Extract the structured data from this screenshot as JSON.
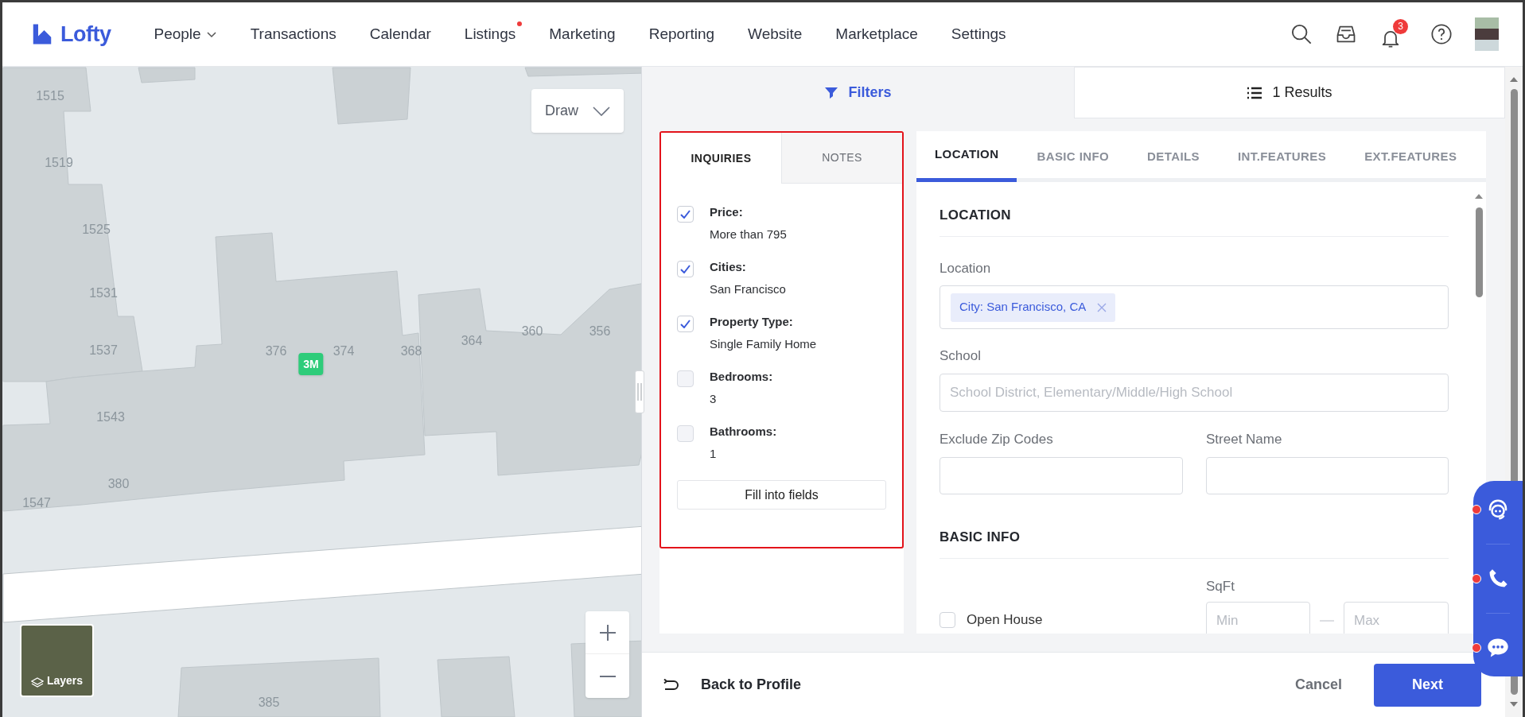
{
  "nav": {
    "logo": "Lofty",
    "items": [
      {
        "label": "People",
        "has_menu": true,
        "has_dot": false
      },
      {
        "label": "Transactions",
        "has_menu": false,
        "has_dot": false
      },
      {
        "label": "Calendar",
        "has_menu": false,
        "has_dot": false
      },
      {
        "label": "Listings",
        "has_menu": false,
        "has_dot": true
      },
      {
        "label": "Marketing",
        "has_menu": false,
        "has_dot": false
      },
      {
        "label": "Reporting",
        "has_menu": false,
        "has_dot": false
      },
      {
        "label": "Website",
        "has_menu": false,
        "has_dot": false
      },
      {
        "label": "Marketplace",
        "has_menu": false,
        "has_dot": false
      },
      {
        "label": "Settings",
        "has_menu": false,
        "has_dot": false
      }
    ],
    "notification_count": "3"
  },
  "map": {
    "house_numbers": [
      "1515",
      "1519",
      "1525",
      "1531",
      "1537",
      "1543",
      "380",
      "1547",
      "376",
      "374",
      "368",
      "364",
      "360",
      "356",
      "385"
    ],
    "marker": "3M",
    "draw_button": "Draw",
    "layers_button": "Layers"
  },
  "view_tabs": [
    {
      "label": "Filters",
      "kind": "filter",
      "selected": true
    },
    {
      "label": "1 Results",
      "kind": "list",
      "selected": false
    }
  ],
  "inquiries": {
    "tabs": [
      {
        "label": "INQUIRIES",
        "selected": true
      },
      {
        "label": "NOTES",
        "selected": false
      }
    ],
    "items": [
      {
        "label": "Price:",
        "value": "More than 795",
        "checked": true
      },
      {
        "label": "Cities:",
        "value": "San Francisco",
        "checked": true
      },
      {
        "label": "Property Type:",
        "value": "Single Family Home",
        "checked": true
      },
      {
        "label": "Bedrooms:",
        "value": "3",
        "checked": false
      },
      {
        "label": "Bathrooms:",
        "value": "1",
        "checked": false
      }
    ],
    "fill_button": "Fill into fields"
  },
  "form": {
    "tabs": [
      {
        "label": "LOCATION",
        "selected": true
      },
      {
        "label": "BASIC INFO",
        "selected": false
      },
      {
        "label": "DETAILS",
        "selected": false
      },
      {
        "label": "INT.FEATURES",
        "selected": false
      },
      {
        "label": "EXT.FEATURES",
        "selected": false
      }
    ],
    "location_heading": "LOCATION",
    "location_label": "Location",
    "location_tags": [
      "City: San Francisco, CA"
    ],
    "school_label": "School",
    "school_placeholder": "School District, Elementary/Middle/High School",
    "exclude_zip_label": "Exclude Zip Codes",
    "street_name_label": "Street Name",
    "basic_info_heading": "BASIC INFO",
    "open_house": {
      "label": "Open House",
      "checked": false
    },
    "sqft_label": "SqFt",
    "sqft_min_placeholder": "Min",
    "sqft_max_placeholder": "Max"
  },
  "footer": {
    "back": "Back to Profile",
    "cancel": "Cancel",
    "next": "Next"
  }
}
